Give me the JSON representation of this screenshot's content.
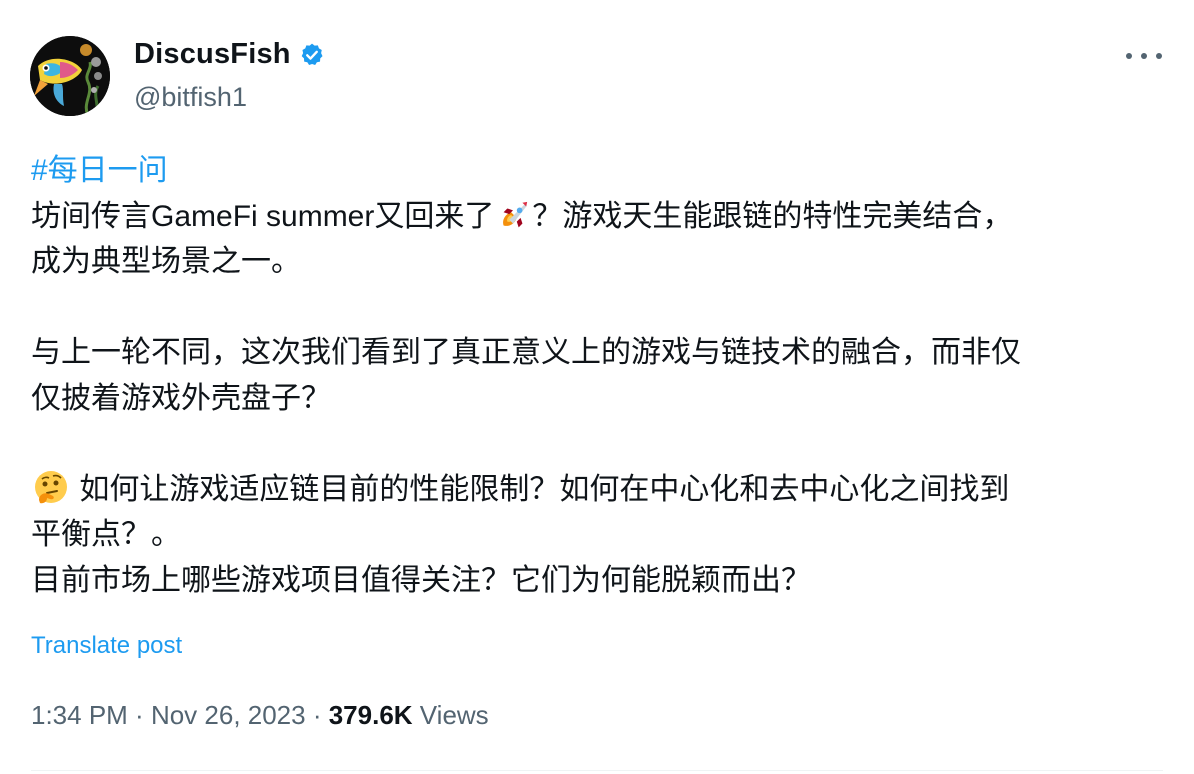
{
  "author": {
    "display_name": "DiscusFish",
    "handle": "@bitfish1",
    "verified": true,
    "avatar_icon": "fish-avatar"
  },
  "post": {
    "hashtag": "#每日一问",
    "line1_before_emoji": "坊间传言GameFi summer又回来了",
    "line1_emoji": "rocket-emoji",
    "line1_after_emoji": "？游戏天生能跟链的特性完美结合，",
    "line2": "成为典型场景之一。",
    "para2_line1": "与上一轮不同，这次我们看到了真正意义上的游戏与链技术的融合，而非仅",
    "para2_line2": "仅披着游戏外壳盘子？",
    "para3_emoji": "thinking-face-emoji",
    "para3_line1": "如何让游戏适应链目前的性能限制？如何在中心化和去中心化之间找到",
    "para3_line2": "平衡点？。",
    "para3_line3": "目前市场上哪些游戏项目值得关注？它们为何能脱颖而出？"
  },
  "translate_label": "Translate post",
  "meta": {
    "time": "1:34 PM",
    "separator": " · ",
    "date": "Nov 26, 2023",
    "views_count": "379.6K",
    "views_label": "Views"
  },
  "colors": {
    "link": "#1d9bf0",
    "text": "#0f1419",
    "secondary": "#536471"
  }
}
